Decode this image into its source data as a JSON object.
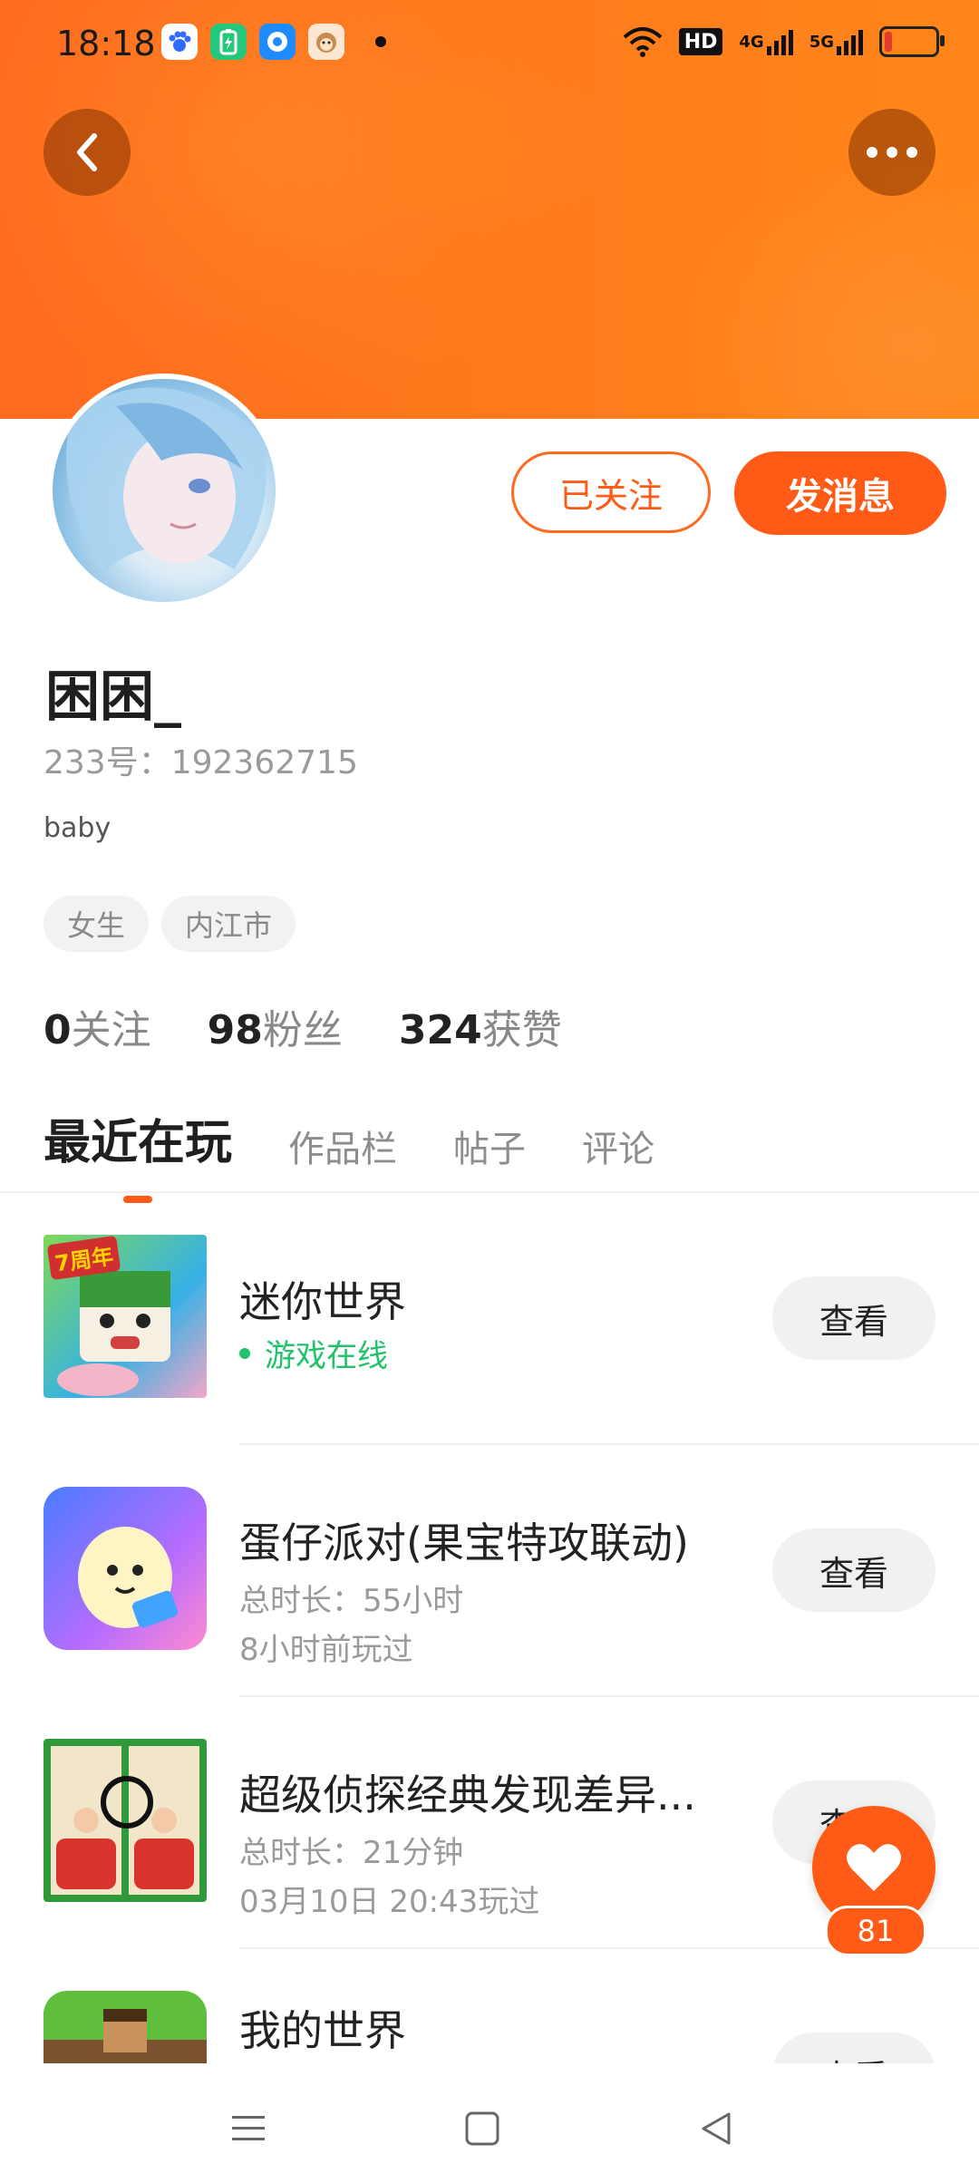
{
  "status_bar": {
    "time": "18:18",
    "hd_label": "HD",
    "net_1": "4G",
    "net_2": "5G"
  },
  "header": {
    "back_icon": "chevron-left-icon",
    "more_icon": "more-horizontal-icon"
  },
  "profile": {
    "follow_label": "已关注",
    "message_label": "发消息",
    "name": "困困_",
    "uid_text": "233号：192362715",
    "bio": "baby",
    "tags": [
      "女生",
      "内江市"
    ],
    "stats": [
      {
        "num": "0",
        "label": "关注"
      },
      {
        "num": "98",
        "label": "粉丝"
      },
      {
        "num": "324",
        "label": "获赞"
      }
    ]
  },
  "tabs": [
    "最近在玩",
    "作品栏",
    "帖子",
    "评论"
  ],
  "games": [
    {
      "title": "迷你世界",
      "status": "游戏在线",
      "action": "查看",
      "icon_badge": "7周年"
    },
    {
      "title": "蛋仔派对(果宝特攻联动)",
      "line1": "总时长：55小时",
      "line2": "8小时前玩过",
      "action": "查看"
    },
    {
      "title": "超级侦探经典发现差异...",
      "line1": "总时长：21分钟",
      "line2": "03月10日 20:43玩过",
      "action": "查看"
    },
    {
      "title": "我的世界",
      "action": "查看"
    }
  ],
  "like_fab": {
    "count": "81",
    "icon": "heart-icon"
  },
  "colors": {
    "accent": "#ff5a16",
    "online": "#21c26b"
  }
}
